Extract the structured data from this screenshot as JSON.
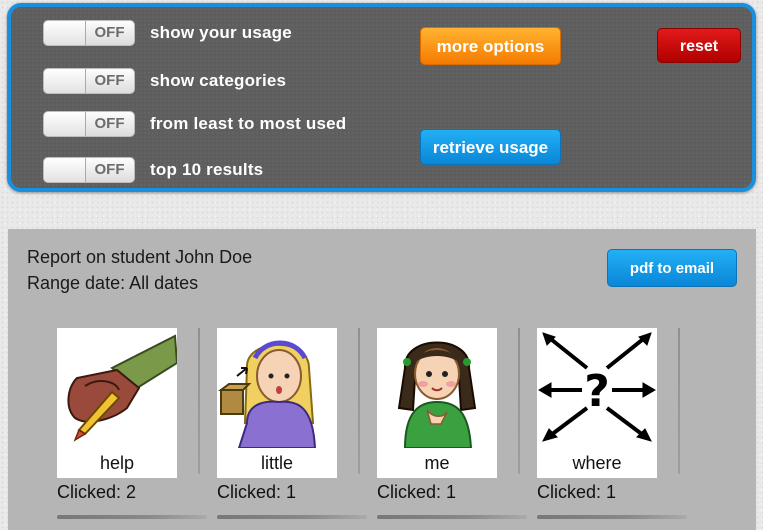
{
  "controls": {
    "toggles": [
      {
        "state": "OFF",
        "label": "show your usage"
      },
      {
        "state": "OFF",
        "label": "show categories"
      },
      {
        "state": "OFF",
        "label": "from least to most used"
      },
      {
        "state": "OFF",
        "label": "top 10 results"
      }
    ],
    "more_options_label": "more options",
    "reset_label": "reset",
    "retrieve_usage_label": "retrieve usage"
  },
  "report": {
    "heading": "Report on student John Doe",
    "range": "Range date: All dates",
    "pdf_button_label": "pdf to email",
    "cards": [
      {
        "word": "help",
        "clicked": "Clicked: 2",
        "icon": "help-symbol-icon"
      },
      {
        "word": "little",
        "clicked": "Clicked: 1",
        "icon": "little-symbol-icon"
      },
      {
        "word": "me",
        "clicked": "Clicked: 1",
        "icon": "me-symbol-icon"
      },
      {
        "word": "where",
        "clicked": "Clicked: 1",
        "icon": "where-symbol-icon"
      }
    ]
  },
  "colors": {
    "panel_border": "#1a8fdc",
    "orange_button": "#f57b00",
    "red_button": "#c00000",
    "blue_button": "#0a86d7"
  }
}
